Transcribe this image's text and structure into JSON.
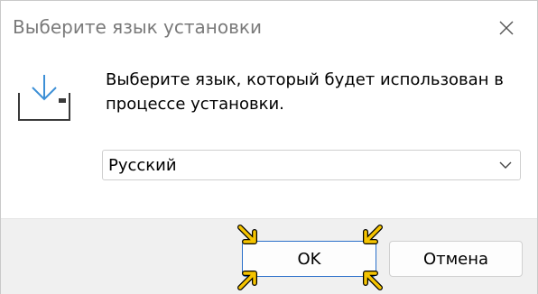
{
  "window": {
    "title": "Выберите язык установки"
  },
  "content": {
    "message": "Выберите язык, который будет использован в процессе установки.",
    "icon": "install-download-icon"
  },
  "language_select": {
    "selected": "Русский"
  },
  "buttons": {
    "ok_label": "OK",
    "cancel_label": "Отмена"
  },
  "colors": {
    "accent": "#2a6fc9",
    "highlight_arrows": "#f5c400",
    "footer_bg": "#f0f0f0",
    "title_text": "#7a7a7a"
  }
}
